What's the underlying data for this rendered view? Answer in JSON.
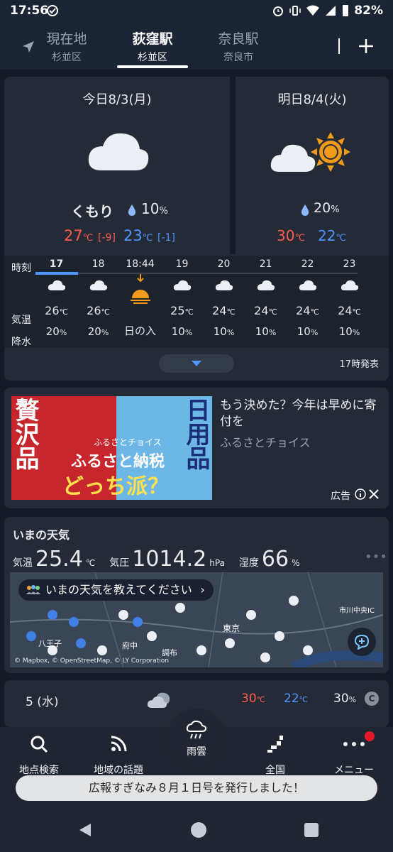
{
  "status": {
    "time": "17:56",
    "battery": "82%"
  },
  "locations": [
    {
      "name": "現在地",
      "sub": "杉並区"
    },
    {
      "name": "荻窪駅",
      "sub": "杉並区"
    },
    {
      "name": "奈良駅",
      "sub": "奈良市"
    }
  ],
  "today": {
    "title": "今日8/3(月)",
    "condition": "くもり",
    "rain": "10",
    "rain_unit": "%",
    "high": "27",
    "high_diff": "[-9]",
    "low": "23",
    "low_diff": "[-1]",
    "unit": "℃"
  },
  "tomorrow": {
    "title": "明日8/4(火)",
    "rain": "20",
    "rain_unit": "%",
    "high": "30",
    "low": "22",
    "unit": "℃"
  },
  "hourly": {
    "row_labels": {
      "time": "時刻",
      "temp": "気温",
      "rain": "降水"
    },
    "hours": [
      {
        "time": "17",
        "icon": "cloud-icon",
        "temp": "26",
        "rain": "20"
      },
      {
        "time": "18",
        "icon": "cloud-icon",
        "temp": "26",
        "rain": "20"
      },
      {
        "time": "18:44",
        "icon": "sunset-icon",
        "temp": "",
        "rain": "日の入"
      },
      {
        "time": "19",
        "icon": "cloud-icon",
        "temp": "25",
        "rain": "10"
      },
      {
        "time": "20",
        "icon": "cloud-icon",
        "temp": "24",
        "rain": "10"
      },
      {
        "time": "21",
        "icon": "cloud-icon",
        "temp": "24",
        "rain": "10"
      },
      {
        "time": "22",
        "icon": "cloud-icon",
        "temp": "24",
        "rain": "10"
      },
      {
        "time": "23",
        "icon": "cloud-icon",
        "temp": "24",
        "rain": "10"
      }
    ],
    "unit_temp": "℃",
    "unit_rain": "%",
    "issued": "17時発表"
  },
  "ad": {
    "img_left": "贅沢品",
    "img_right": "日用品",
    "img_brand": "ふるさとチョイス",
    "img_main1": "ふるさと納税",
    "img_main2": "どっち派？",
    "headline": "もう決めた？今年は早めに寄付を",
    "sponsor": "ふるさとチョイス",
    "label": "広告"
  },
  "current": {
    "title": "いまの天気",
    "temp_label": "気温",
    "temp": "25.4",
    "temp_unit": "℃",
    "pressure_label": "気圧",
    "pressure": "1014.2",
    "pressure_unit": "hPa",
    "humidity_label": "湿度",
    "humidity": "66",
    "humidity_unit": "%",
    "prompt": "いまの天気を教えてください",
    "attribution": "© Mapbox, © OpenStreetMap, © LY Corporation",
    "map_labels": [
      "東京",
      "八王子",
      "府中",
      "調布",
      "市川中央IC"
    ]
  },
  "weekly_row": {
    "day": "5",
    "weekday": "(水)",
    "high": "30",
    "low": "22",
    "unit": "℃",
    "rain": "30",
    "rain_unit": "%"
  },
  "nav": {
    "search": "地点検索",
    "topics": "地域の話題",
    "rain": "雨雲",
    "national": "全国",
    "menu": "メニュー"
  },
  "toast": "広報すぎなみ８月１日号を発行しました！"
}
